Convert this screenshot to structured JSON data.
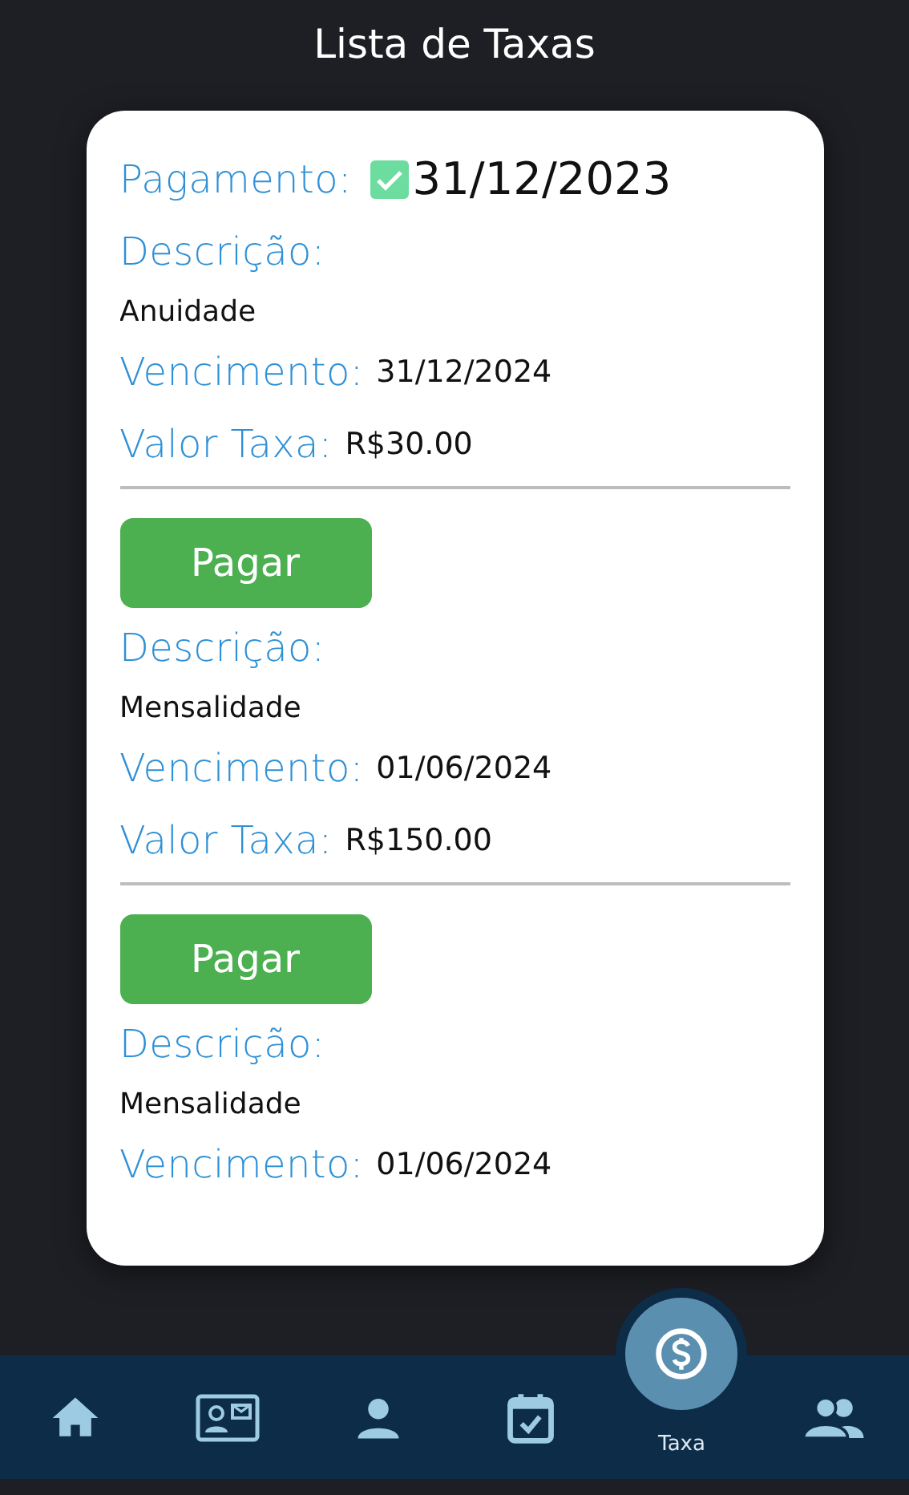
{
  "title": "Lista de Taxas",
  "fees": [
    {
      "kind": "paid",
      "payment_label": "Pagamento:",
      "paid": true,
      "payment_date": "31/12/2023",
      "description_label": "Descrição:",
      "description": "Anuidade",
      "due_label": "Vencimento:",
      "due": "31/12/2024",
      "amount_label": "Valor Taxa:",
      "amount": "R$30.00"
    },
    {
      "kind": "pending",
      "button": "Pagar",
      "description_label": "Descrição:",
      "description": "Mensalidade",
      "due_label": "Vencimento:",
      "due": "01/06/2024",
      "amount_label": "Valor Taxa:",
      "amount": "R$150.00"
    },
    {
      "kind": "pending",
      "button": "Pagar",
      "description_label": "Descrição:",
      "description": "Mensalidade",
      "due_label": "Vencimento:",
      "due": "01/06/2024"
    }
  ],
  "nav": [
    {
      "kind": "home",
      "selected": false
    },
    {
      "kind": "card",
      "selected": false
    },
    {
      "kind": "person",
      "selected": false
    },
    {
      "kind": "calendar",
      "selected": false
    },
    {
      "kind": "money",
      "label": "Taxa",
      "selected": true
    },
    {
      "kind": "group",
      "selected": false
    }
  ]
}
